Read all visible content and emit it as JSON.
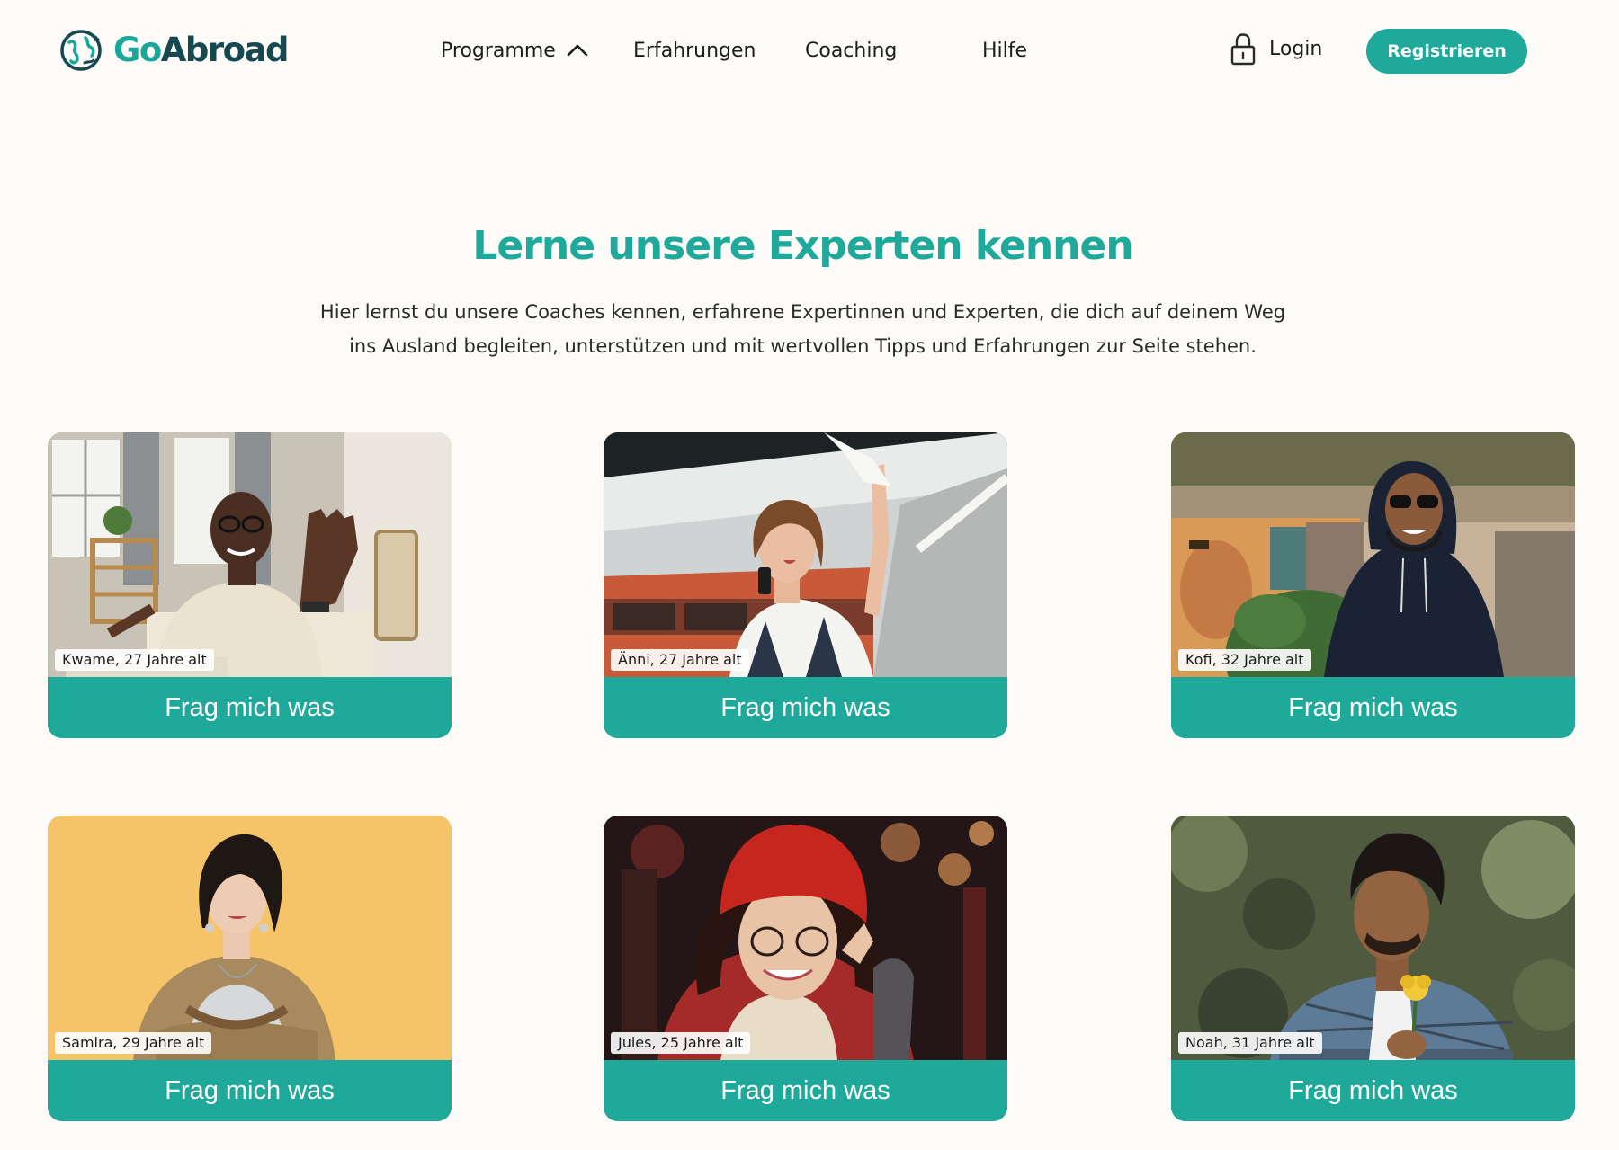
{
  "header": {
    "logo": {
      "part1": "Go",
      "part2": "Abroad"
    },
    "nav": {
      "programme": "Programme",
      "erfahrungen": "Erfahrungen",
      "coaching": "Coaching",
      "hilfe": "Hilfe"
    },
    "login_label": "Login",
    "register_label": "Registrieren"
  },
  "intro": {
    "title": "Lerne unsere Experten kennen",
    "description": "Hier lernst du unsere Coaches kennen, erfahrene Expertinnen und Experten, die dich auf deinem Weg ins Ausland begleiten, unterstützen und mit wertvollen Tipps und Erfahrungen zur Seite stehen."
  },
  "coaches": [
    {
      "name_age": "Kwame, 27 Jahre alt",
      "button": "Frag mich was"
    },
    {
      "name_age": "Änni, 27 Jahre alt",
      "button": "Frag mich was"
    },
    {
      "name_age": "Kofi, 32 Jahre alt",
      "button": "Frag mich was"
    },
    {
      "name_age": "Samira, 29 Jahre alt",
      "button": "Frag mich was"
    },
    {
      "name_age": "Jules, 25 Jahre alt",
      "button": "Frag mich was"
    },
    {
      "name_age": "Noah, 31 Jahre alt",
      "button": "Frag mich was"
    }
  ],
  "colors": {
    "brand": "#1fa99b",
    "brand_dark": "#16484f",
    "background": "#fcfbf7"
  }
}
